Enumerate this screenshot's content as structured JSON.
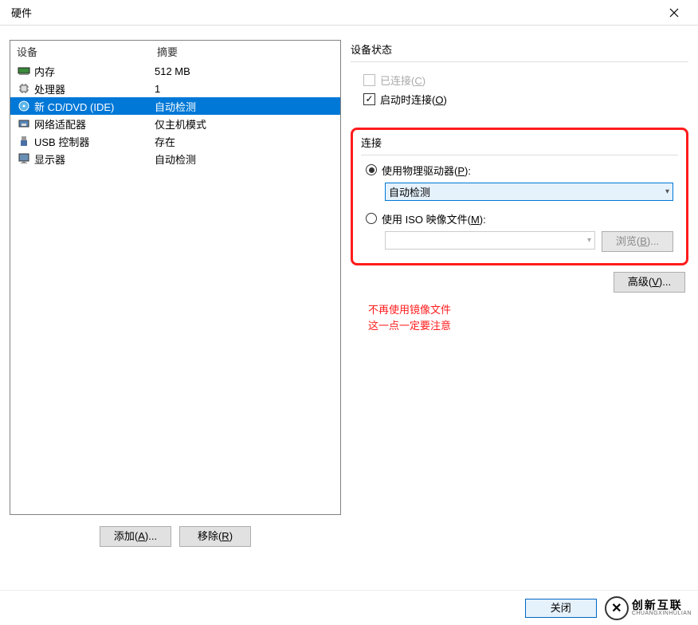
{
  "window": {
    "title": "硬件"
  },
  "hw_list": {
    "col_device": "设备",
    "col_summary": "摘要",
    "rows": [
      {
        "name": "内存",
        "summary": "512 MB",
        "icon": "memory"
      },
      {
        "name": "处理器",
        "summary": "1",
        "icon": "cpu"
      },
      {
        "name": "新 CD/DVD (IDE)",
        "summary": "自动检测",
        "icon": "disc",
        "selected": true
      },
      {
        "name": "网络适配器",
        "summary": "仅主机模式",
        "icon": "nic"
      },
      {
        "name": "USB 控制器",
        "summary": "存在",
        "icon": "usb"
      },
      {
        "name": "显示器",
        "summary": "自动检测",
        "icon": "monitor"
      }
    ]
  },
  "buttons": {
    "add": "添加(A)...",
    "remove": "移除(R)",
    "advanced": "高级(V)...",
    "browse": "浏览(B)...",
    "close": "关闭"
  },
  "device_state": {
    "title": "设备状态",
    "connected": "已连接(C)",
    "connect_on_start": "启动时连接(O)"
  },
  "connection": {
    "title": "连接",
    "use_physical": "使用物理驱动器(P):",
    "physical_value": "自动检测",
    "use_iso": "使用 ISO 映像文件(M):"
  },
  "annotation": {
    "line1": "不再使用镜像文件",
    "line2": "这一点一定要注意"
  },
  "brand": {
    "cn": "创新互联",
    "en": "CHUANGXINHULIAN"
  }
}
